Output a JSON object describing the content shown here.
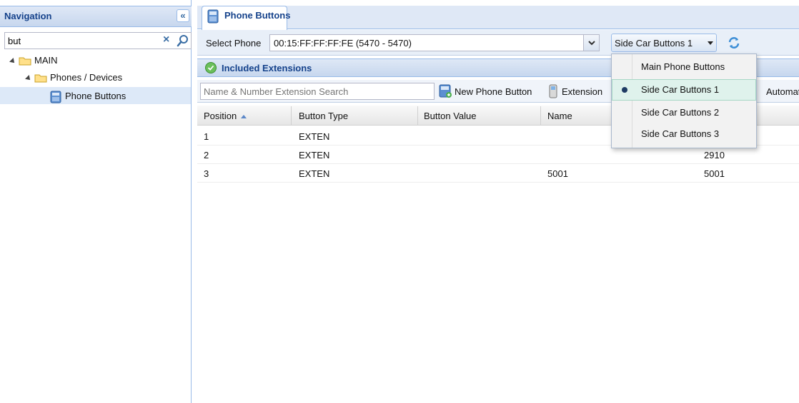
{
  "nav": {
    "title": "Navigation",
    "collapse_glyph": "«",
    "search": {
      "value": "but",
      "placeholder": ""
    },
    "clear_glyph": "×",
    "tree": [
      {
        "label": "MAIN",
        "icon": "folder-icon",
        "expanded": true
      },
      {
        "label": "Phones / Devices",
        "icon": "folder-icon",
        "expanded": true
      },
      {
        "label": "Phone Buttons",
        "icon": "phone-buttons-icon",
        "selected": true
      }
    ]
  },
  "tabs": [
    {
      "label": "Phone Buttons",
      "active": true
    }
  ],
  "toolbar": {
    "select_phone_label": "Select Phone",
    "phone_value": "00:15:FF:FF:FF:FE (5470 - 5470)",
    "button_set_value": "Side Car Buttons 1"
  },
  "included": {
    "title": "Included Extensions",
    "search_placeholder": "Name & Number Extension Search",
    "new_button_label": "New Phone Button",
    "extension_label": "Extension",
    "auto_label": "Automati"
  },
  "grid": {
    "columns": [
      "Position",
      "Button Type",
      "Button Value",
      "Name",
      ""
    ],
    "rows": [
      [
        "1",
        "EXTEN",
        "",
        "",
        ""
      ],
      [
        "2",
        "EXTEN",
        "",
        "",
        "2910"
      ],
      [
        "3",
        "EXTEN",
        "",
        "5001",
        "5001"
      ]
    ]
  },
  "menu": {
    "items": [
      "Main Phone Buttons",
      "Side Car Buttons 1",
      "Side Car Buttons 2",
      "Side Car Buttons 3"
    ],
    "selected_index": 1
  },
  "colors": {
    "header_text": "#15428b",
    "border": "#99bbe8",
    "selected_row": "#dde9f8",
    "menu_selected": "#dff2ec"
  }
}
